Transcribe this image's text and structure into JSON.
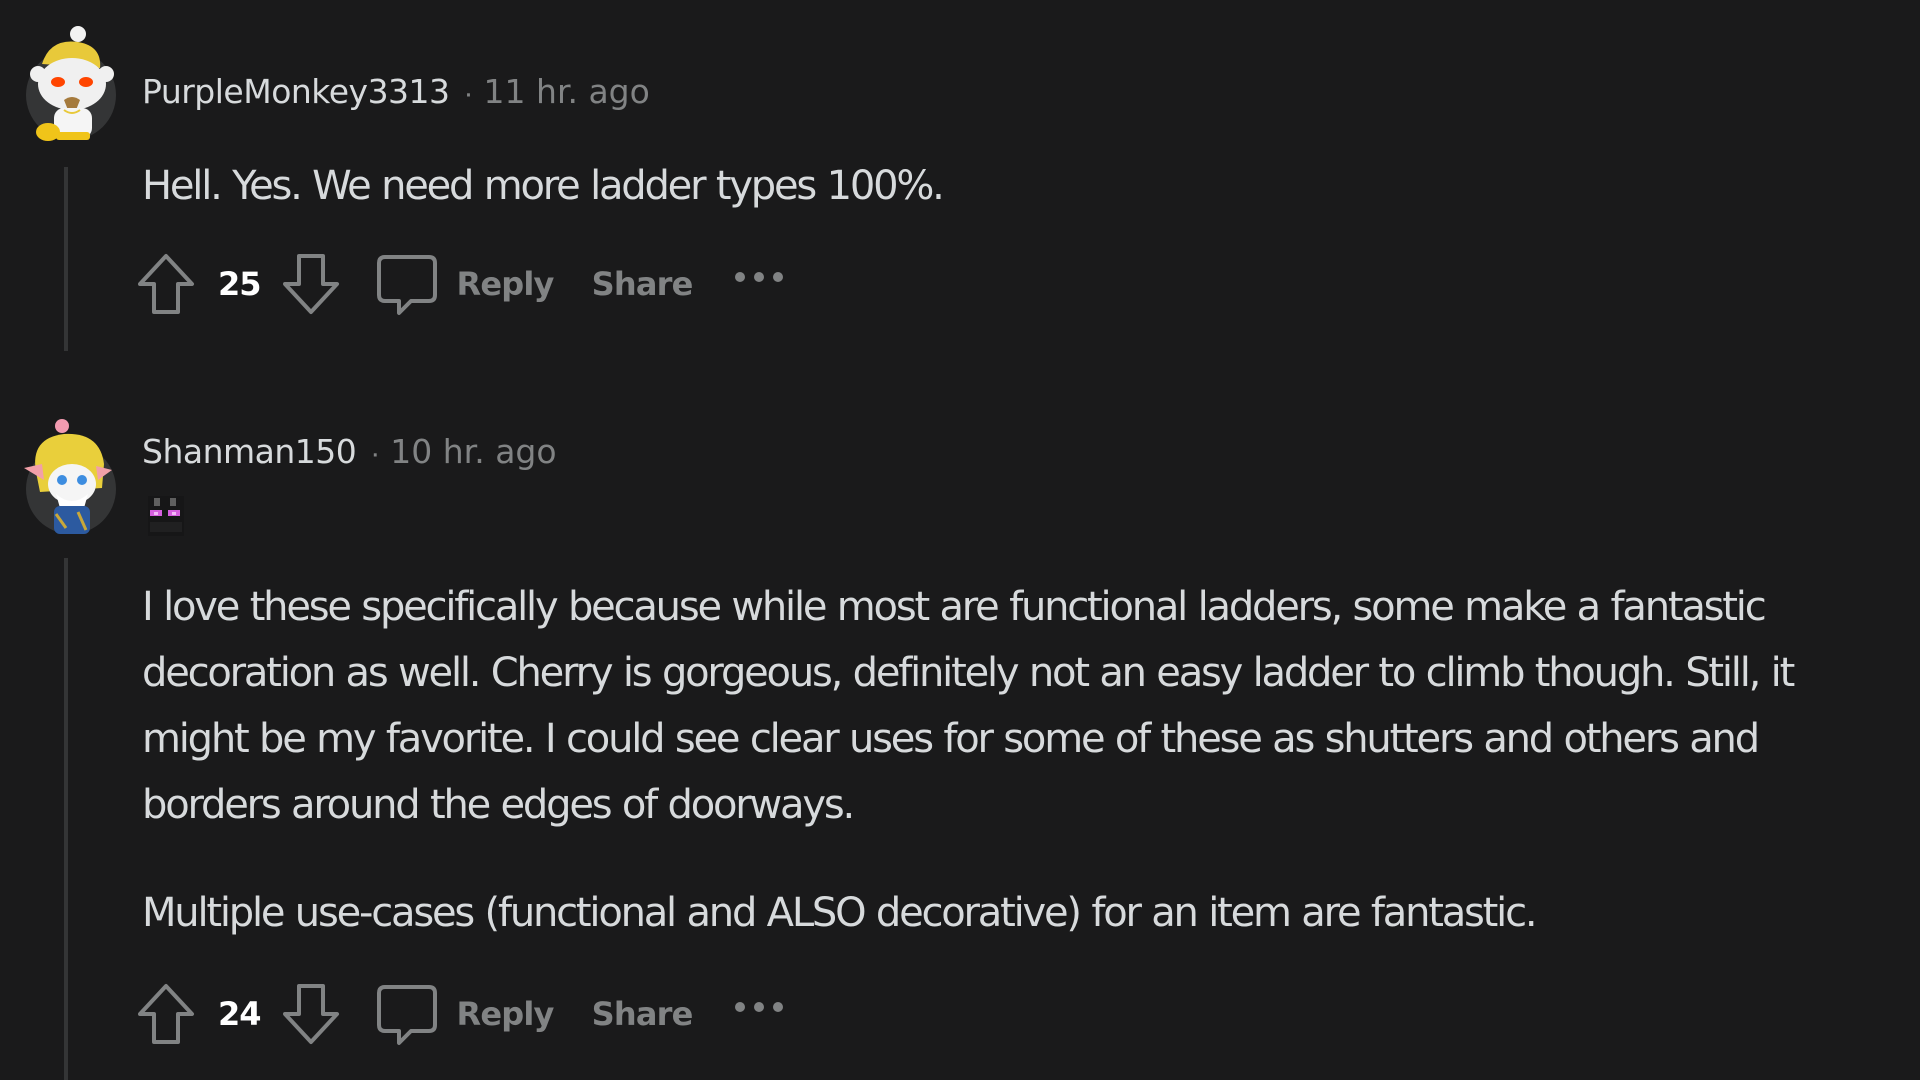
{
  "comments": [
    {
      "username": "PurpleMonkey3313",
      "separator": "·",
      "timestamp": "11 hr. ago",
      "avatar": "snoo-avatar-blonde-hair-red-eyes-icon",
      "flair": null,
      "body": [
        "Hell. Yes. We need more ladder types 100%."
      ],
      "score": "25",
      "actions": {
        "reply": "Reply",
        "share": "Share",
        "more": "more-options-icon"
      }
    },
    {
      "username": "Shanman150",
      "separator": "·",
      "timestamp": "10 hr. ago",
      "avatar": "snoo-avatar-blonde-hair-blue-armor-icon",
      "flair": "enderman-head-flair-icon",
      "body": [
        "I love these specifically because while most are functional ladders, some make a fantastic decoration as well. Cherry is gorgeous, definitely not an easy ladder to climb though. Still, it might be my favorite. I could see clear uses for some of these as shutters and others and borders around the edges of doorways.",
        "Multiple use-cases (functional and ALSO decorative) for an item are fantastic."
      ],
      "score": "24",
      "actions": {
        "reply": "Reply",
        "share": "Share",
        "more": "more-options-icon"
      }
    }
  ],
  "colors": {
    "background": "#1a1a1b",
    "text_primary": "#d7dadc",
    "text_secondary": "#818384",
    "thread_line": "#343536",
    "score": "#ffffff"
  }
}
